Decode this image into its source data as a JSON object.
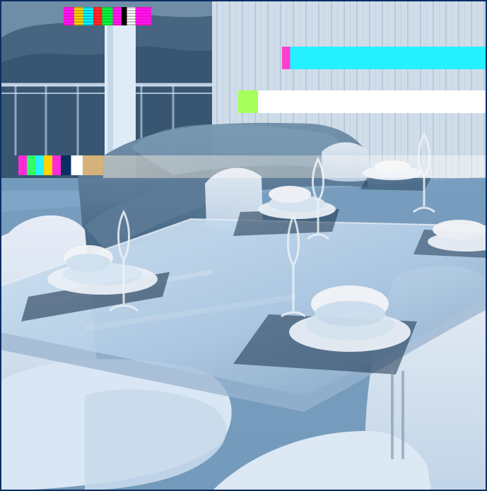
{
  "image": {
    "caption": "",
    "alt": "",
    "palette": {
      "frame_border": "#0b2e63",
      "table_glass": "#b8d4ea",
      "chairs": "#e9f4ff",
      "floor": "#7aa5c6",
      "artifact_cyan": "#24f0ff",
      "artifact_magenta": "#ff2bd6",
      "artifact_white": "#ffffff",
      "artifact_tan": "#d6b27a"
    }
  }
}
